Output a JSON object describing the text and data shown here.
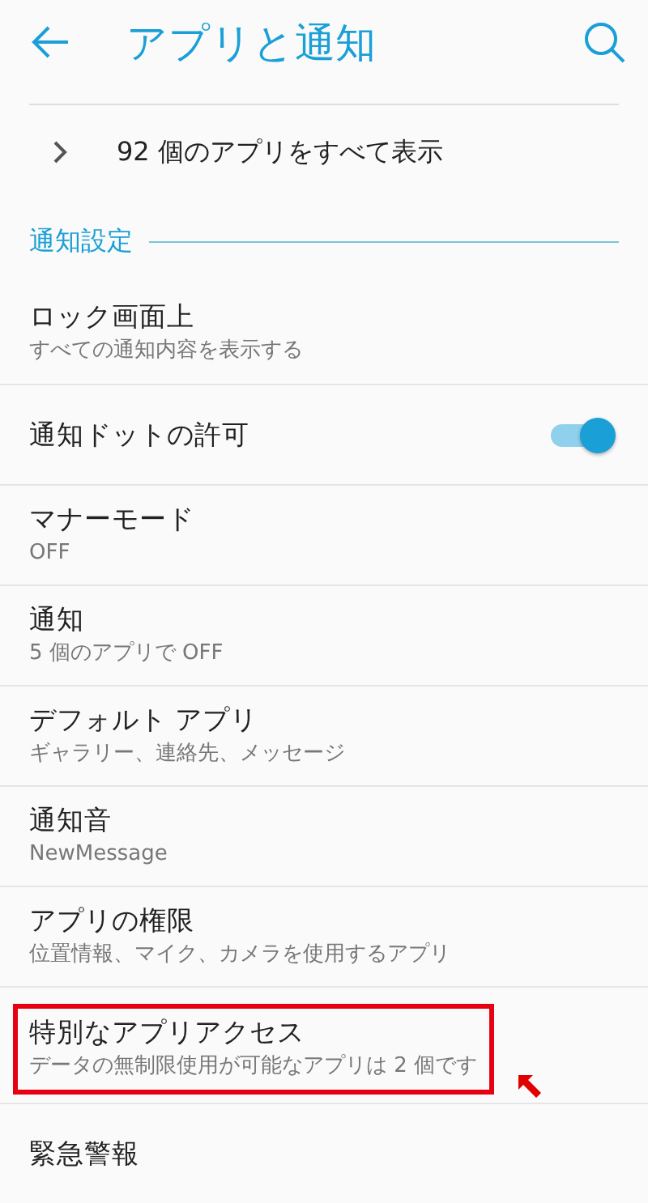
{
  "header": {
    "title": "アプリと通知"
  },
  "all_apps": {
    "label": "92 個のアプリをすべて表示"
  },
  "section": {
    "title": "通知設定"
  },
  "items": [
    {
      "kind": "text",
      "title": "ロック画面上",
      "subtitle": "すべての通知内容を表示する",
      "highlighted": false
    },
    {
      "kind": "toggle",
      "title": "通知ドットの許可",
      "on": true,
      "highlighted": false
    },
    {
      "kind": "text",
      "title": "マナーモード",
      "subtitle": "OFF",
      "highlighted": false
    },
    {
      "kind": "text",
      "title": "通知",
      "subtitle": "5 個のアプリで OFF",
      "highlighted": false
    },
    {
      "kind": "text",
      "title": "デフォルト アプリ",
      "subtitle": "ギャラリー、連絡先、メッセージ",
      "highlighted": false
    },
    {
      "kind": "text",
      "title": "通知音",
      "subtitle": "NewMessage",
      "highlighted": false
    },
    {
      "kind": "text",
      "title": "アプリの権限",
      "subtitle": "位置情報、マイク、カメラを使用するアプリ",
      "highlighted": false
    },
    {
      "kind": "text",
      "title": "特別なアプリアクセス",
      "subtitle": "データの無制限使用が可能なアプリは 2 個です",
      "highlighted": true
    },
    {
      "kind": "text",
      "title": "緊急警報",
      "highlighted": false
    }
  ]
}
